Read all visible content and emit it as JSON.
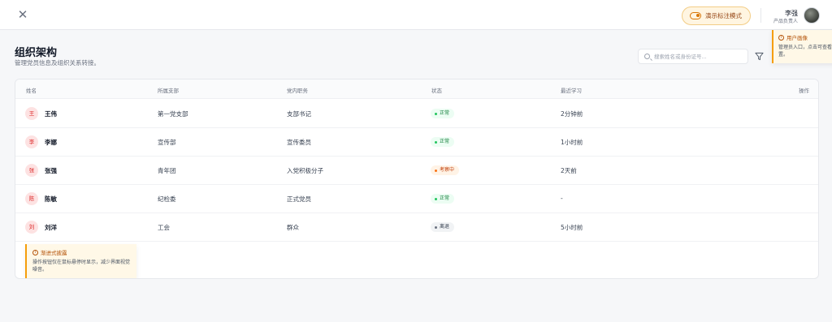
{
  "topbar": {
    "close_icon": "close-icon",
    "demo_mode_label": "演示标注模式",
    "user": {
      "name": "李强",
      "role": "产品负责人"
    }
  },
  "tips": {
    "user_profile": {
      "title": "用户画像",
      "body": "管理员入口，点击可查看配置。"
    },
    "progressive": {
      "title": "渐进式披露",
      "body": "操作按钮仅在鼠标悬停时显示，减少界面视觉噪音。"
    }
  },
  "page": {
    "title": "组织架构",
    "subtitle": "管理党员信息及组织关系转接。"
  },
  "search": {
    "placeholder": "搜索姓名或身份证号..."
  },
  "table": {
    "headers": {
      "name": "姓名",
      "branch": "所属支部",
      "role": "党内职务",
      "status": "状态",
      "recent": "最近学习",
      "action": "操作"
    },
    "rows": [
      {
        "avatar": "王",
        "name": "王伟",
        "branch": "第一党支部",
        "role": "支部书记",
        "status": "正常",
        "status_kind": "green",
        "recent": "2分钟前"
      },
      {
        "avatar": "李",
        "name": "李娜",
        "branch": "宣传部",
        "role": "宣传委员",
        "status": "正常",
        "status_kind": "green",
        "recent": "1小时前"
      },
      {
        "avatar": "张",
        "name": "张强",
        "branch": "青年团",
        "role": "入党积极分子",
        "status": "考察中",
        "status_kind": "orange",
        "recent": "2天前"
      },
      {
        "avatar": "陈",
        "name": "陈敏",
        "branch": "纪检委",
        "role": "正式党员",
        "status": "正常",
        "status_kind": "green",
        "recent": "-"
      },
      {
        "avatar": "刘",
        "name": "刘洋",
        "branch": "工会",
        "role": "群众",
        "status": "离退",
        "status_kind": "gray",
        "recent": "5小时前"
      }
    ]
  },
  "colors": {
    "accent": "#f59e0b",
    "green": "#22c55e",
    "orange": "#f97316",
    "avatar_bg": "#fde2e2"
  }
}
